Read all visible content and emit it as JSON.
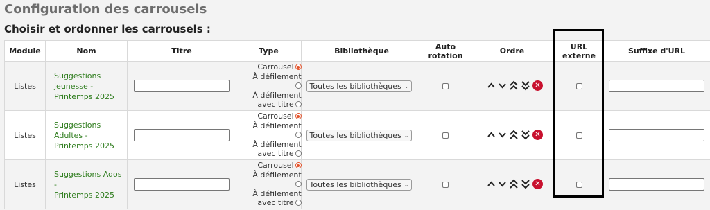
{
  "page": {
    "title": "Configuration des carrousels",
    "section_title": "Choisir et ordonner les carrousels :"
  },
  "table": {
    "headers": {
      "module": "Module",
      "nom": "Nom",
      "titre": "Titre",
      "type": "Type",
      "bibliotheque": "Bibliothèque",
      "auto_rotation_line1": "Auto",
      "auto_rotation_line2": "rotation",
      "ordre": "Ordre",
      "url_externe_line1": "URL",
      "url_externe_line2": "externe",
      "suffixe_url": "Suffixe d'URL"
    },
    "type_options": {
      "carrousel": "Carrousel",
      "defilement": "À défilement",
      "defilement_titre_line1": "À défilement",
      "defilement_titre_line2": "avec titre"
    },
    "rows": [
      {
        "module": "Listes",
        "nom_lines": [
          "Suggestions",
          "jeunesse -",
          "Printemps 2025"
        ],
        "titre_value": "",
        "type_selected": "carrousel",
        "bibliotheque": "Toutes les bibliothèques",
        "auto_rotation": false,
        "url_externe": false,
        "suffixe_value": ""
      },
      {
        "module": "Listes",
        "nom_lines": [
          "Suggestions",
          "Adultes -",
          "Printemps 2025"
        ],
        "titre_value": "",
        "type_selected": "carrousel",
        "bibliotheque": "Toutes les bibliothèques",
        "auto_rotation": false,
        "url_externe": false,
        "suffixe_value": ""
      },
      {
        "module": "Listes",
        "nom_lines": [
          "Suggestions Ados -",
          "Printemps 2025"
        ],
        "titre_value": "",
        "type_selected": "carrousel",
        "bibliotheque": "Toutes les bibliothèques",
        "auto_rotation": false,
        "url_externe": false,
        "suffixe_value": ""
      }
    ]
  },
  "icons": {
    "move_up": "chevron-up-icon",
    "move_down": "chevron-down-icon",
    "move_top": "double-chevron-up-icon",
    "move_bottom": "double-chevron-down-icon",
    "delete": "delete-x-icon"
  },
  "colors": {
    "link_green": "#2f7d1e",
    "radio_orange": "#e3522a",
    "delete_red": "#c8102e",
    "highlight_border": "#000000"
  }
}
